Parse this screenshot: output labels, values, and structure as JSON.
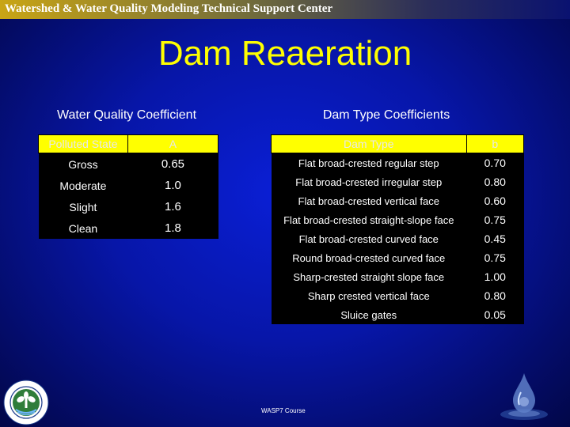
{
  "header": {
    "title": "Watershed & Water Quality Modeling Technical Support Center"
  },
  "page": {
    "title": "Dam Reaeration"
  },
  "water_quality": {
    "heading": "Water Quality Coefficient",
    "columns": [
      "Polluted State",
      "A"
    ],
    "rows": [
      [
        "Gross",
        "0.65"
      ],
      [
        "Moderate",
        "1.0"
      ],
      [
        "Slight",
        "1.6"
      ],
      [
        "Clean",
        "1.8"
      ]
    ]
  },
  "dam_type": {
    "heading": "Dam Type Coefficients",
    "columns": [
      "Dam Type",
      "b"
    ],
    "rows": [
      [
        "Flat broad-crested regular step",
        "0.70"
      ],
      [
        "Flat broad-crested irregular step",
        "0.80"
      ],
      [
        "Flat broad-crested vertical face",
        "0.60"
      ],
      [
        "Flat broad-crested straight-slope face",
        "0.75"
      ],
      [
        "Flat broad-crested curved face",
        "0.45"
      ],
      [
        "Round broad-crested curved face",
        "0.75"
      ],
      [
        "Sharp-crested straight slope face",
        "1.00"
      ],
      [
        "Sharp crested vertical face",
        "0.80"
      ],
      [
        "Sluice gates",
        "0.05"
      ]
    ]
  },
  "footer": {
    "text": "WASP7 Course"
  },
  "logos": {
    "left": "epa-seal-icon",
    "right": "water-drop-logo-icon"
  }
}
